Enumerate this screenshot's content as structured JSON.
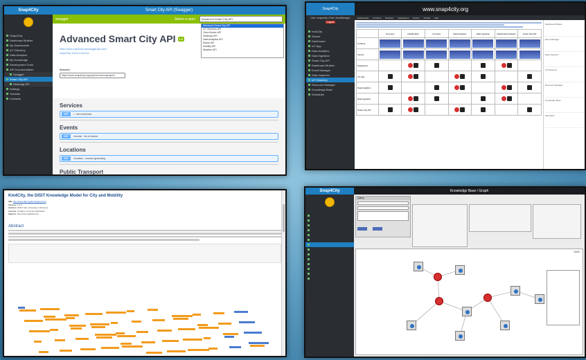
{
  "panel1": {
    "brand": "Snap4City",
    "window_title": "Smart City API (Swagger)",
    "swagger_brand": "swagger",
    "select_label": "Select a spec",
    "select_value": "Advanced Smart City API",
    "dropdown_options": [
      "Advanced Smart City API",
      "IoT Directory API",
      "Orion Broker API",
      "Heatmap API",
      "Data Analytics API",
      "Kbase API",
      "Mobility API",
      "Weather API"
    ],
    "title": "Advanced Smart City API",
    "badge": "1.0",
    "links": [
      "https://www.snap4city.org/swagger/api.yaml",
      "Snap4City Terms of service"
    ],
    "servers_label": "Servers",
    "server_value": "https://www.snap4city.org/superservicemap/api/v1",
    "sections": [
      {
        "name": "Services",
        "verb": "GET",
        "path": "/ - list of services"
      },
      {
        "name": "Events",
        "verb": "GET",
        "path": "/events/ - list of events"
      },
      {
        "name": "Locations",
        "verb": "GET",
        "path": "/location/ - reverse geocoding"
      },
      {
        "name": "Public Transport",
        "verb": "",
        "path": ""
      }
    ],
    "sidebar": [
      "Snap4City",
      "Dashboard Builder",
      "My Dashboards",
      "IoT Directory",
      "Data Analytics",
      "My Knowledge",
      "Development Tools",
      "API Documentation",
      "Swagger",
      "Smart City API",
      "Heatmap API",
      "Settings",
      "Tutorials",
      "Contacts"
    ]
  },
  "panel2": {
    "brand": "Snap4City",
    "site_title": "www.snap4city.org",
    "user": "User: snap4city | Role: AreaManager",
    "logout": "Logout",
    "menu": [
      "Dashboards",
      "Contacts",
      "Structure",
      "Applications",
      "Events",
      "Portals",
      "Help"
    ],
    "columns": [
      "Overview",
      "Dashboards",
      "IoT Apps",
      "Data Analytics",
      "Data Ingestion",
      "Dashboard Analytics",
      "Smart City API"
    ],
    "rows": [
      "Km4City",
      "Sensor",
      "Dashboard",
      "IoT App",
      "Data Analytics",
      "Data Ingestion",
      "Smart City API"
    ],
    "right_items": [
      "Dashboard Builder",
      "Event Manager",
      "Data Inspector",
      "IoT Directory",
      "Resource Manager",
      "Knowledge Base",
      "Scheduler"
    ]
  },
  "panel3": {
    "title": "Km4City, the DISIT Knowledge Model for City and Mobility",
    "meta": [
      {
        "k": "URI:",
        "v": "http://www.disit.org/km4city/schema"
      },
      {
        "k": "Version:",
        "v": "1.6.6"
      },
      {
        "k": "Authors:",
        "v": "DISIT Lab, University of Florence"
      },
      {
        "k": "License:",
        "v": "Creative Commons Attribution"
      },
      {
        "k": "Imports:",
        "v": "http://purl.org/dc/terms/"
      }
    ],
    "abstract_heading": "Abstract"
  },
  "panel4": {
    "brand": "Snap4City",
    "window_title": "Knowledge Base / Graph",
    "query_label": "Query",
    "zoom": "100%"
  }
}
